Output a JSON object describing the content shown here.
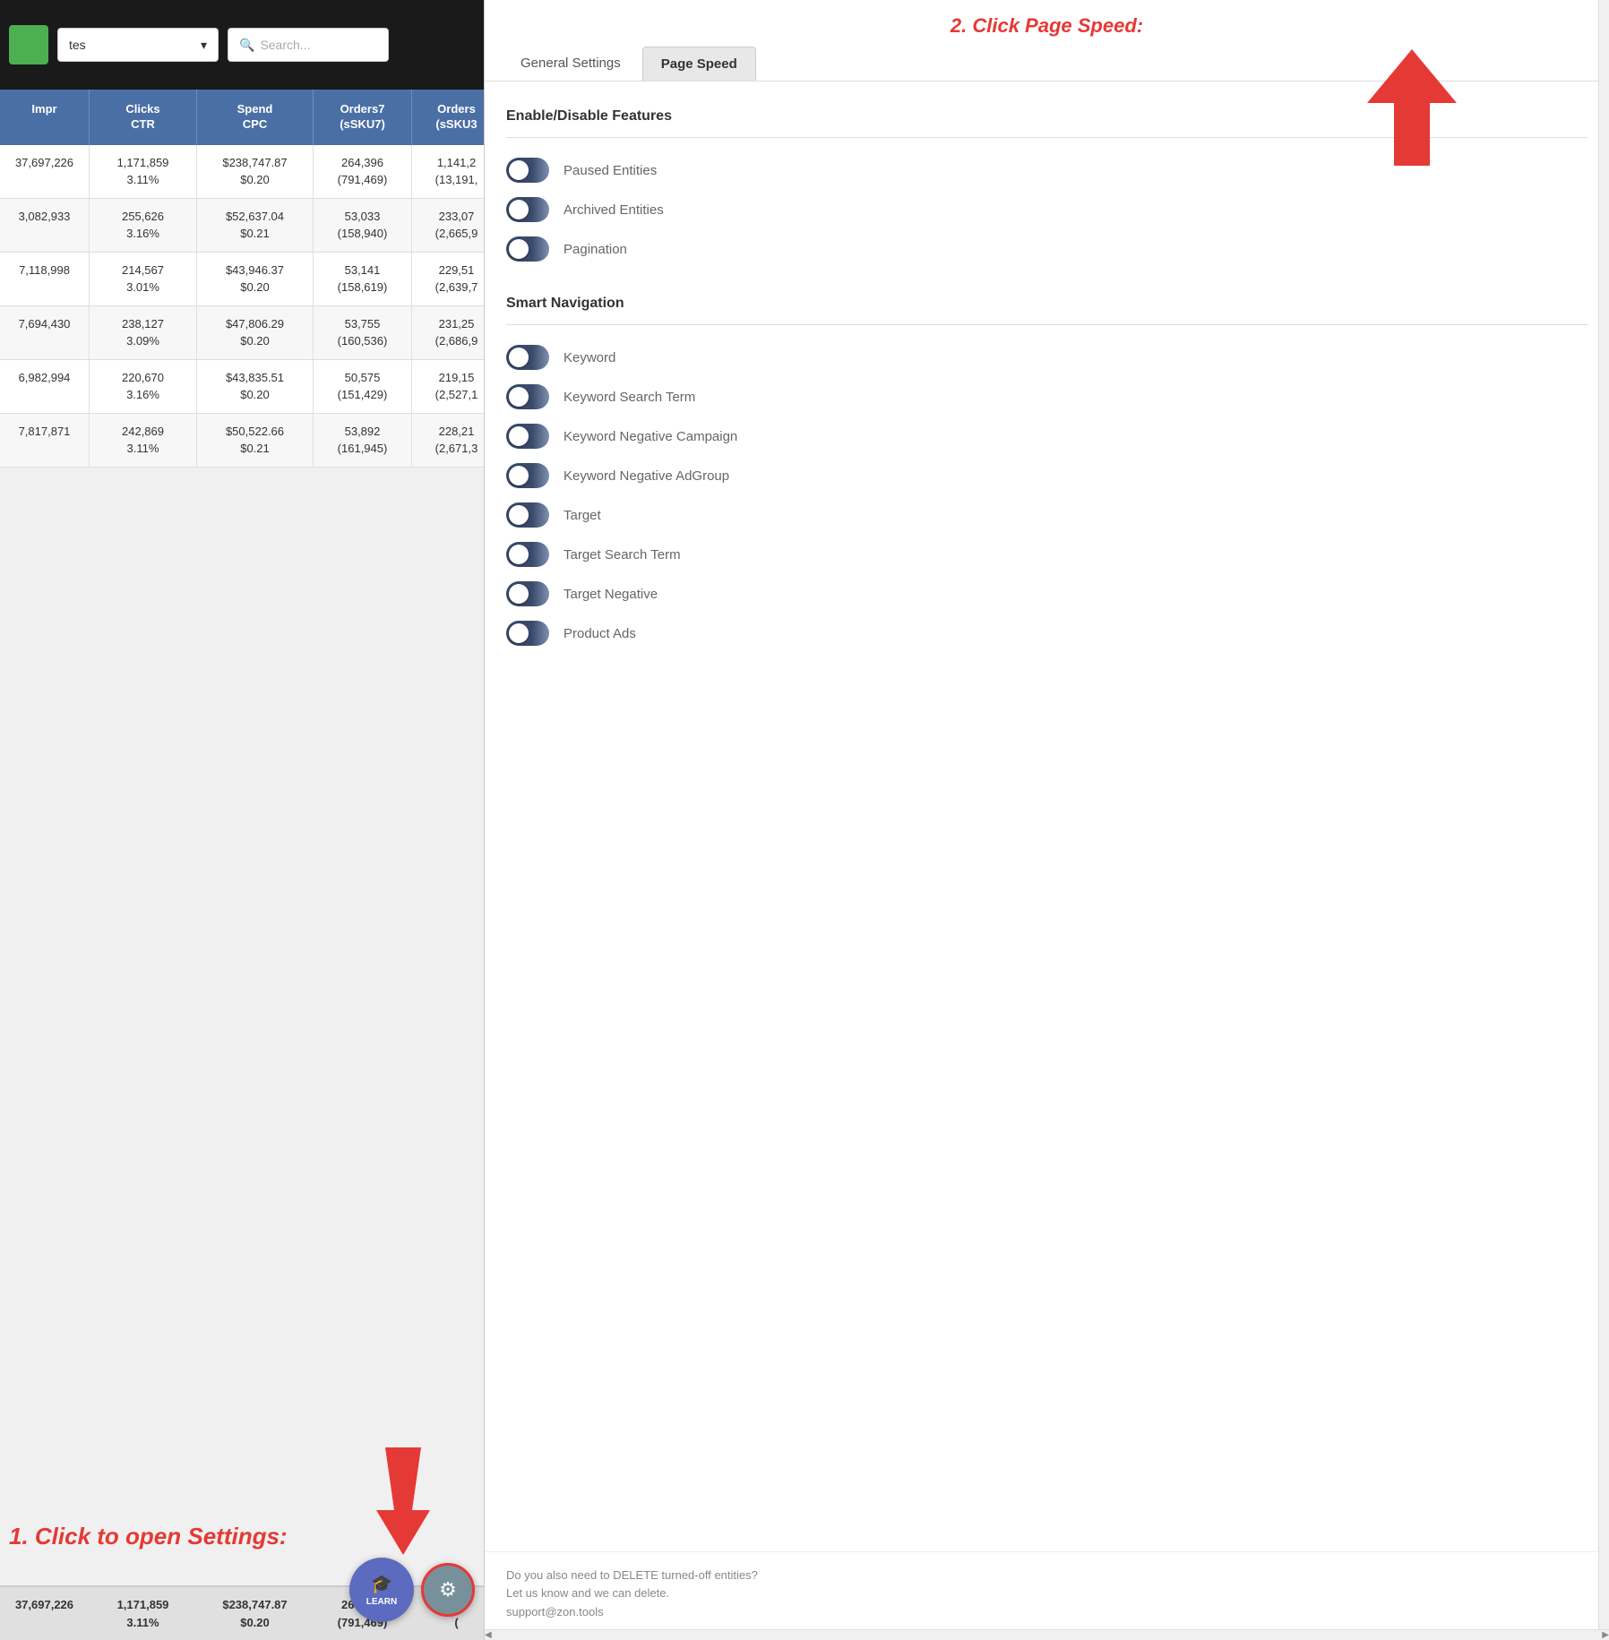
{
  "left": {
    "filter_placeholder": "tes",
    "search_placeholder": "Search...",
    "table": {
      "headers": [
        {
          "label": "Impr"
        },
        {
          "label": "Clicks\nCTR"
        },
        {
          "label": "Spend\nCPC"
        },
        {
          "label": "Orders7\n(sSKU7)"
        },
        {
          "label": "Orders\n(sSKU3"
        }
      ],
      "rows": [
        [
          "37,697,226",
          "1,171,859\n3.11%",
          "$238,747.87\n$0.20",
          "264,396\n(791,469)",
          "1,141,2\n(13,191,"
        ],
        [
          "3,082,933",
          "255,626\n3.16%",
          "$52,637.04\n$0.21",
          "53,033\n(158,940)",
          "233,07\n(2,665,9"
        ],
        [
          "7,118,998",
          "214,567\n3.01%",
          "$43,946.37\n$0.20",
          "53,141\n(158,619)",
          "229,51\n(2,639,7"
        ],
        [
          "7,694,430",
          "238,127\n3.09%",
          "$47,806.29\n$0.20",
          "53,755\n(160,536)",
          "231,25\n(2,686,9"
        ],
        [
          "6,982,994",
          "220,670\n3.16%",
          "$43,835.51\n$0.20",
          "50,575\n(151,429)",
          "219,15\n(2,527,1"
        ],
        [
          "7,817,871",
          "242,869\n3.11%",
          "$50,522.66\n$0.21",
          "53,892\n(161,945)",
          "228,21\n(2,671,3"
        ]
      ],
      "footer": [
        "37,697,226",
        "1,171,859\n3.11%",
        "$238,747.87\n$0.20",
        "264,396\n(791,469)",
        "41,2\n("
      ]
    },
    "annotation": "1. Click to open Settings:",
    "learn_label": "LEARN",
    "settings_label": "⚙"
  },
  "right": {
    "top_annotation": "2. Click Page Speed:",
    "tabs": [
      {
        "label": "General Settings",
        "active": false
      },
      {
        "label": "Page Speed",
        "active": true
      }
    ],
    "sections": [
      {
        "title": "Enable/Disable Features",
        "items": [
          {
            "label": "Paused Entities",
            "enabled": true
          },
          {
            "label": "Archived Entities",
            "enabled": true
          },
          {
            "label": "Pagination",
            "enabled": true
          }
        ]
      },
      {
        "title": "Smart Navigation",
        "items": [
          {
            "label": "Keyword",
            "enabled": true
          },
          {
            "label": "Keyword Search Term",
            "enabled": true
          },
          {
            "label": "Keyword Negative Campaign",
            "enabled": true
          },
          {
            "label": "Keyword Negative AdGroup",
            "enabled": true
          },
          {
            "label": "Target",
            "enabled": true
          },
          {
            "label": "Target Search Term",
            "enabled": true
          },
          {
            "label": "Target Negative",
            "enabled": true
          },
          {
            "label": "Product Ads",
            "enabled": true
          }
        ]
      }
    ],
    "footer_text": "Do you also need to DELETE turned-off entities?\nLet us know and we can delete.\nsupport@zon.tools"
  }
}
